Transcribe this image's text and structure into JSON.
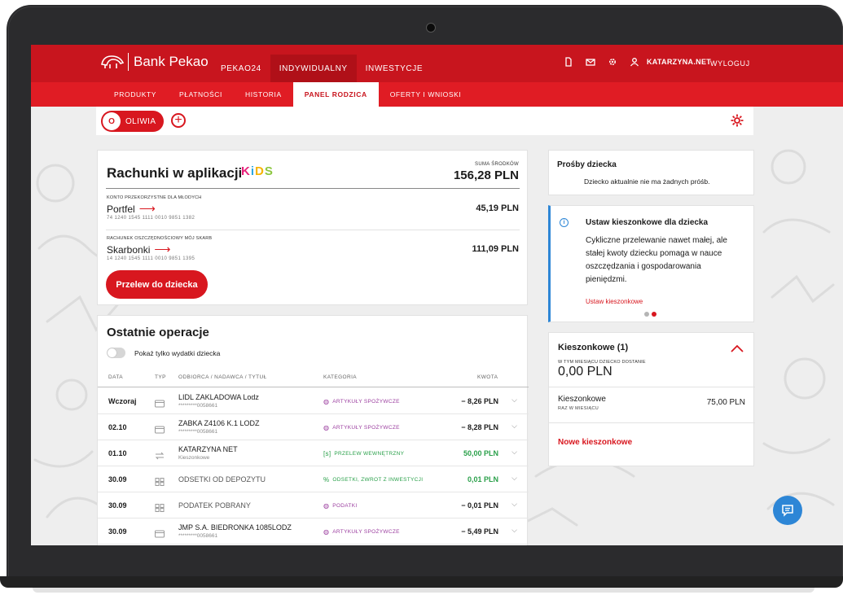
{
  "brand": {
    "name": "Bank Pekao"
  },
  "topnav": {
    "tabs": [
      {
        "label": "PEKAO24",
        "active": false
      },
      {
        "label": "INDYWIDUALNY",
        "active": true
      },
      {
        "label": "INWESTYCJE",
        "active": false
      }
    ],
    "user": "KATARZYNA.NET",
    "logout": "WYLOGUJ",
    "icons": [
      "document-icon",
      "mail-icon",
      "settings-icon",
      "user-icon"
    ]
  },
  "subnav": {
    "tabs": [
      {
        "label": "PRODUKTY",
        "active": false
      },
      {
        "label": "PŁATNOŚCI",
        "active": false
      },
      {
        "label": "HISTORIA",
        "active": false
      },
      {
        "label": "PANEL RODZICA",
        "active": true
      },
      {
        "label": "OFERTY I WNIOSKI",
        "active": false
      }
    ]
  },
  "child": {
    "initial": "O",
    "name": "OLIWIA"
  },
  "accounts": {
    "title": "Rachunki w aplikacji",
    "kids_logo": [
      "K",
      "i",
      "D",
      "S"
    ],
    "sum_label": "SUMA ŚRODKÓW",
    "sum_value": "156,28 PLN",
    "items": [
      {
        "type": "KONTO PRZEKORZYSTNE DLA MŁODYCH",
        "name": "Portfel",
        "number": "74 1240 1545 1111 0010 9851 1382",
        "amount": "45,19 PLN"
      },
      {
        "type": "RACHUNEK OSZCZĘDNOŚCIOWY MÓJ SKARB",
        "name": "Skarbonki",
        "number": "14 1240 1545 1111 0010 9851 1395",
        "amount": "111,09 PLN"
      }
    ],
    "transfer_button": "Przelew do dziecka"
  },
  "operations": {
    "title": "Ostatnie operacje",
    "toggle_label": "Pokaż tylko wydatki dziecka",
    "toggle_on": false,
    "columns": [
      "DATA",
      "TYP",
      "ODBIORCA / NADAWCA / TYTUŁ",
      "KATEGORIA",
      "KWOTA"
    ],
    "rows": [
      {
        "date": "Wczoraj",
        "type": "card",
        "name": "LIDL ZAKLADOWA Lodz",
        "sub": "*********0058661",
        "category": "ARTYKUŁY SPOŻYWCZE",
        "cat_color": "purple",
        "amount": "− 8,26 PLN",
        "positive": false
      },
      {
        "date": "02.10",
        "type": "card",
        "name": "ZABKA Z4106 K.1 LODZ",
        "sub": "*********0058661",
        "category": "ARTYKUŁY SPOŻYWCZE",
        "cat_color": "purple",
        "amount": "− 8,28 PLN",
        "positive": false
      },
      {
        "date": "01.10",
        "type": "transfer",
        "name": "KATARZYNA NET",
        "sub": "Kieszonkowe",
        "category": "PRZELEW WEWNĘTRZNY",
        "cat_color": "green",
        "amount": "50,00 PLN",
        "positive": true
      },
      {
        "date": "30.09",
        "type": "other",
        "name": "ODSETKI OD DEPOZYTU",
        "sub": "",
        "category": "ODSETKI, ZWROT Z INWESTYCJI",
        "cat_color": "green",
        "amount": "0,01 PLN",
        "positive": true
      },
      {
        "date": "30.09",
        "type": "other",
        "name": "PODATEK POBRANY",
        "sub": "",
        "category": "PODATKI",
        "cat_color": "purple",
        "amount": "− 0,01 PLN",
        "positive": false
      },
      {
        "date": "30.09",
        "type": "card",
        "name": "JMP S.A. BIEDRONKA 1085LODZ",
        "sub": "*********0058661",
        "category": "ARTYKUŁY SPOŻYWCZE",
        "cat_color": "purple",
        "amount": "− 5,49 PLN",
        "positive": false
      }
    ]
  },
  "requests": {
    "title": "Prośby dziecka",
    "text": "Dziecko aktualnie nie ma żadnych próśb."
  },
  "promo": {
    "title": "Ustaw kieszonkowe dla dziecka",
    "text": "Cykliczne przelewanie nawet małej, ale stałej kwoty dziecku pomaga w nauce oszczędzania i gospodarowania pieniędzmi.",
    "link": "Ustaw kieszonkowe",
    "slides": 2,
    "active_slide": 2
  },
  "pocket": {
    "title": "Kieszonkowe (1)",
    "sublabel": "W TYM MIESIĄCU DZIECKO DOSTANIE",
    "amount": "0,00 PLN",
    "item_name": "Kieszonkowe",
    "item_freq": "RAZ W MIESIĄCU",
    "item_value": "75,00 PLN",
    "new_link": "Nowe kieszonkowe"
  },
  "colors": {
    "brand_red": "#c8151e",
    "subnav_red": "#e01c24",
    "accent_blue": "#2d86d6",
    "positive_green": "#2aa04a",
    "category_purple": "#9b3e9f"
  }
}
